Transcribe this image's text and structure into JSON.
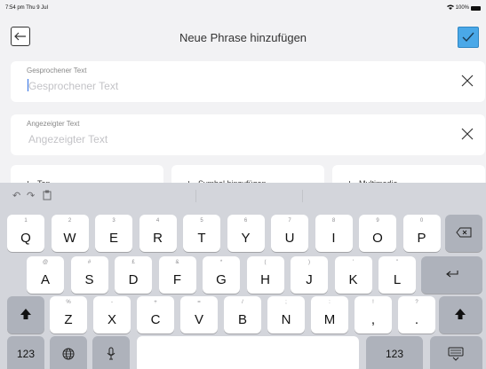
{
  "status": {
    "time": "7:54 pm  Thu 9 Jul",
    "battery": "100%"
  },
  "nav": {
    "title": "Neue Phrase hinzufügen"
  },
  "fields": [
    {
      "label": "Gesprochener Text",
      "placeholder": "Gesprochener Text"
    },
    {
      "label": "Angezeigter Text",
      "placeholder": "Angezeigter Text"
    }
  ],
  "options": [
    {
      "label": "Ton"
    },
    {
      "label": "Symbol hinzufügen"
    },
    {
      "label": "Multimedia"
    }
  ],
  "keyboard": {
    "row1": [
      {
        "sub": "1",
        "main": "Q"
      },
      {
        "sub": "2",
        "main": "W"
      },
      {
        "sub": "3",
        "main": "E"
      },
      {
        "sub": "4",
        "main": "R"
      },
      {
        "sub": "5",
        "main": "T"
      },
      {
        "sub": "6",
        "main": "Y"
      },
      {
        "sub": "7",
        "main": "U"
      },
      {
        "sub": "8",
        "main": "I"
      },
      {
        "sub": "9",
        "main": "O"
      },
      {
        "sub": "0",
        "main": "P"
      }
    ],
    "row2": [
      {
        "sub": "@",
        "main": "A"
      },
      {
        "sub": "#",
        "main": "S"
      },
      {
        "sub": "£",
        "main": "D"
      },
      {
        "sub": "&",
        "main": "F"
      },
      {
        "sub": "*",
        "main": "G"
      },
      {
        "sub": "(",
        "main": "H"
      },
      {
        "sub": ")",
        "main": "J"
      },
      {
        "sub": "'",
        "main": "K"
      },
      {
        "sub": "\"",
        "main": "L"
      }
    ],
    "row3": [
      {
        "sub": "%",
        "main": "Z"
      },
      {
        "sub": "-",
        "main": "X"
      },
      {
        "sub": "+",
        "main": "C"
      },
      {
        "sub": "=",
        "main": "V"
      },
      {
        "sub": "/",
        "main": "B"
      },
      {
        "sub": ";",
        "main": "N"
      },
      {
        "sub": ":",
        "main": "M"
      },
      {
        "sub": "!",
        "main": ","
      },
      {
        "sub": "?",
        "main": "."
      }
    ],
    "num_left": "123",
    "num_right": "123"
  },
  "colors": {
    "accent": "#4aa8e8",
    "keyboard_bg": "#d3d5db"
  }
}
